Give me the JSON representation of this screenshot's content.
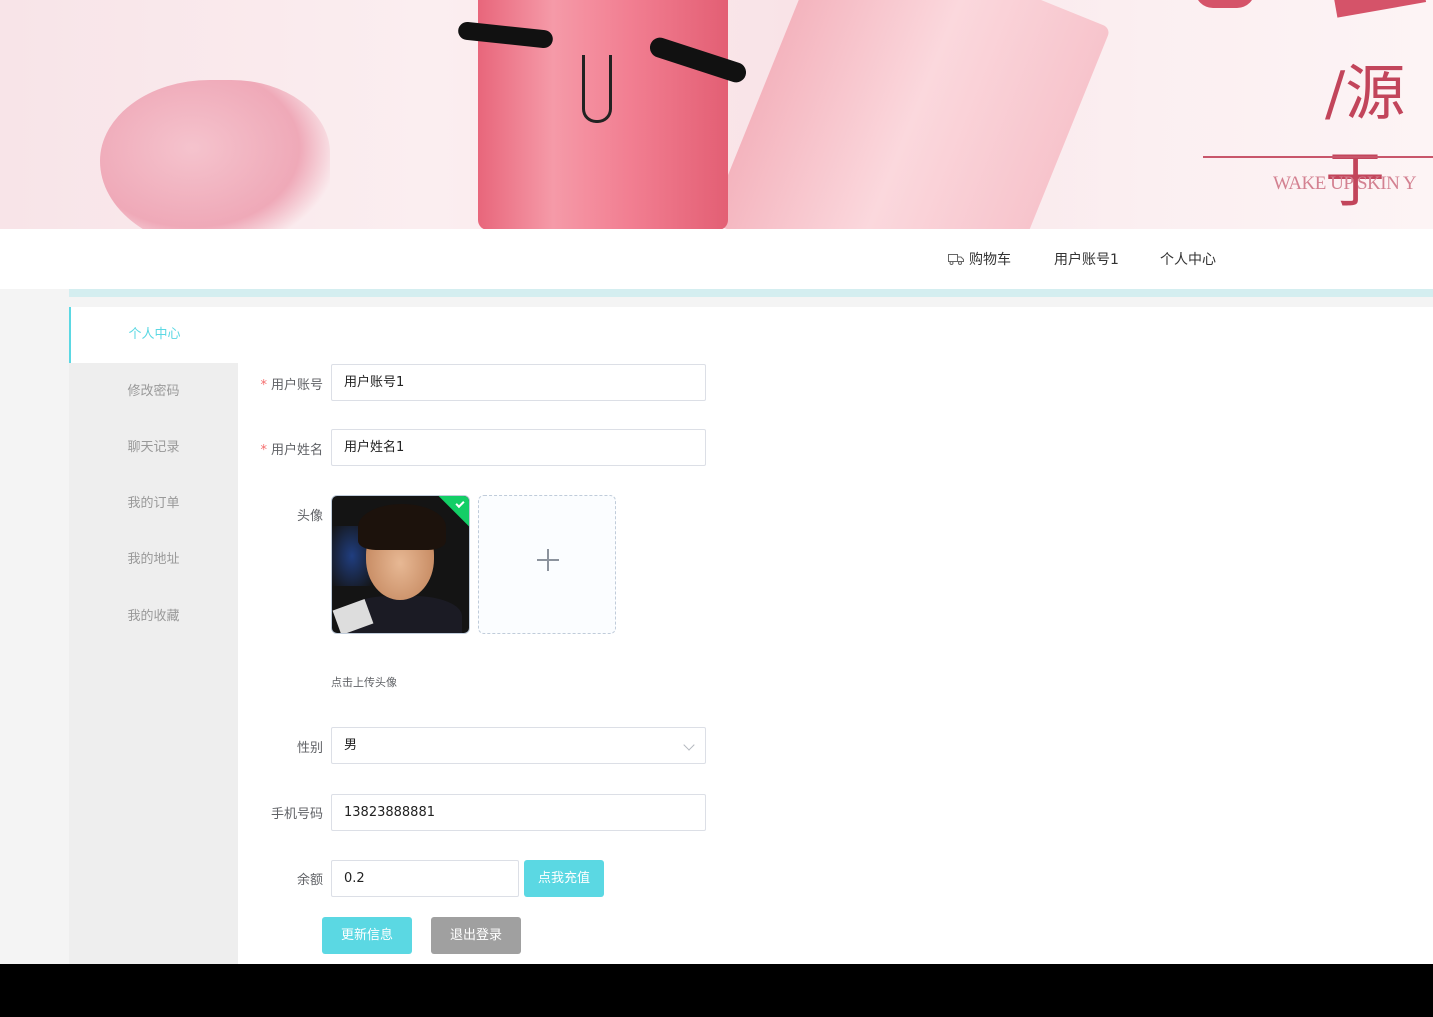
{
  "nav": {
    "cart_label": "购物车",
    "account_label": "用户账号1",
    "center_label": "个人中心",
    "cart_icon": "truck-icon"
  },
  "banner": {
    "slogan_cn": "/源于",
    "slogan_en": "WAKE UP SKIN Y"
  },
  "sidebar": {
    "items": [
      {
        "label": "个人中心",
        "active": true
      },
      {
        "label": "修改密码",
        "active": false
      },
      {
        "label": "聊天记录",
        "active": false
      },
      {
        "label": "我的订单",
        "active": false
      },
      {
        "label": "我的地址",
        "active": false
      },
      {
        "label": "我的收藏",
        "active": false
      }
    ]
  },
  "form": {
    "account": {
      "label": "用户账号",
      "value": "用户账号1",
      "required": true
    },
    "name": {
      "label": "用户姓名",
      "value": "用户姓名1",
      "required": true
    },
    "avatar": {
      "label": "头像",
      "hint": "点击上传头像"
    },
    "gender": {
      "label": "性别",
      "value": "男"
    },
    "phone": {
      "label": "手机号码",
      "value": "13823888881"
    },
    "balance": {
      "label": "余额",
      "value": "0.2",
      "recharge_label": "点我充值"
    },
    "update_label": "更新信息",
    "logout_label": "退出登录"
  },
  "colors": {
    "accent": "#5bd8e3",
    "logout": "#a0a0a0",
    "required": "#f56c6c"
  }
}
